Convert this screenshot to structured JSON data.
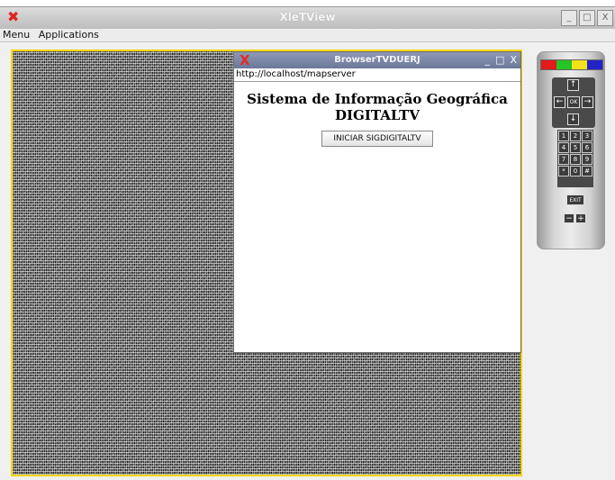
{
  "window": {
    "title": "XleTView",
    "close_glyph": "✖",
    "buttons": [
      "_",
      "□",
      "X"
    ]
  },
  "menubar": {
    "items": [
      "Menu",
      "Applications"
    ]
  },
  "browser": {
    "close_glyph": "X",
    "title": "BrowserTVDUERJ",
    "buttons": [
      "_",
      "□",
      "X"
    ],
    "url": "http://localhost/mapserver",
    "heading_line1": "Sistema de Informação Geográfica",
    "heading_line2": "DIGITALTV",
    "start_button": "INICIAR SIGDIGITALTV"
  },
  "remote": {
    "colors": [
      "#e21b1b",
      "#27c427",
      "#f2e21a",
      "#2323c8"
    ],
    "arrows": {
      "up": "↑",
      "down": "↓",
      "left": "←",
      "right": "→",
      "ok": "OK"
    },
    "numbers": [
      "1",
      "2",
      "3",
      "4",
      "5",
      "6",
      "7",
      "8",
      "9",
      "*",
      "0",
      "#"
    ],
    "exit": "EXIT",
    "vol_minus": "−",
    "vol_plus": "+"
  }
}
